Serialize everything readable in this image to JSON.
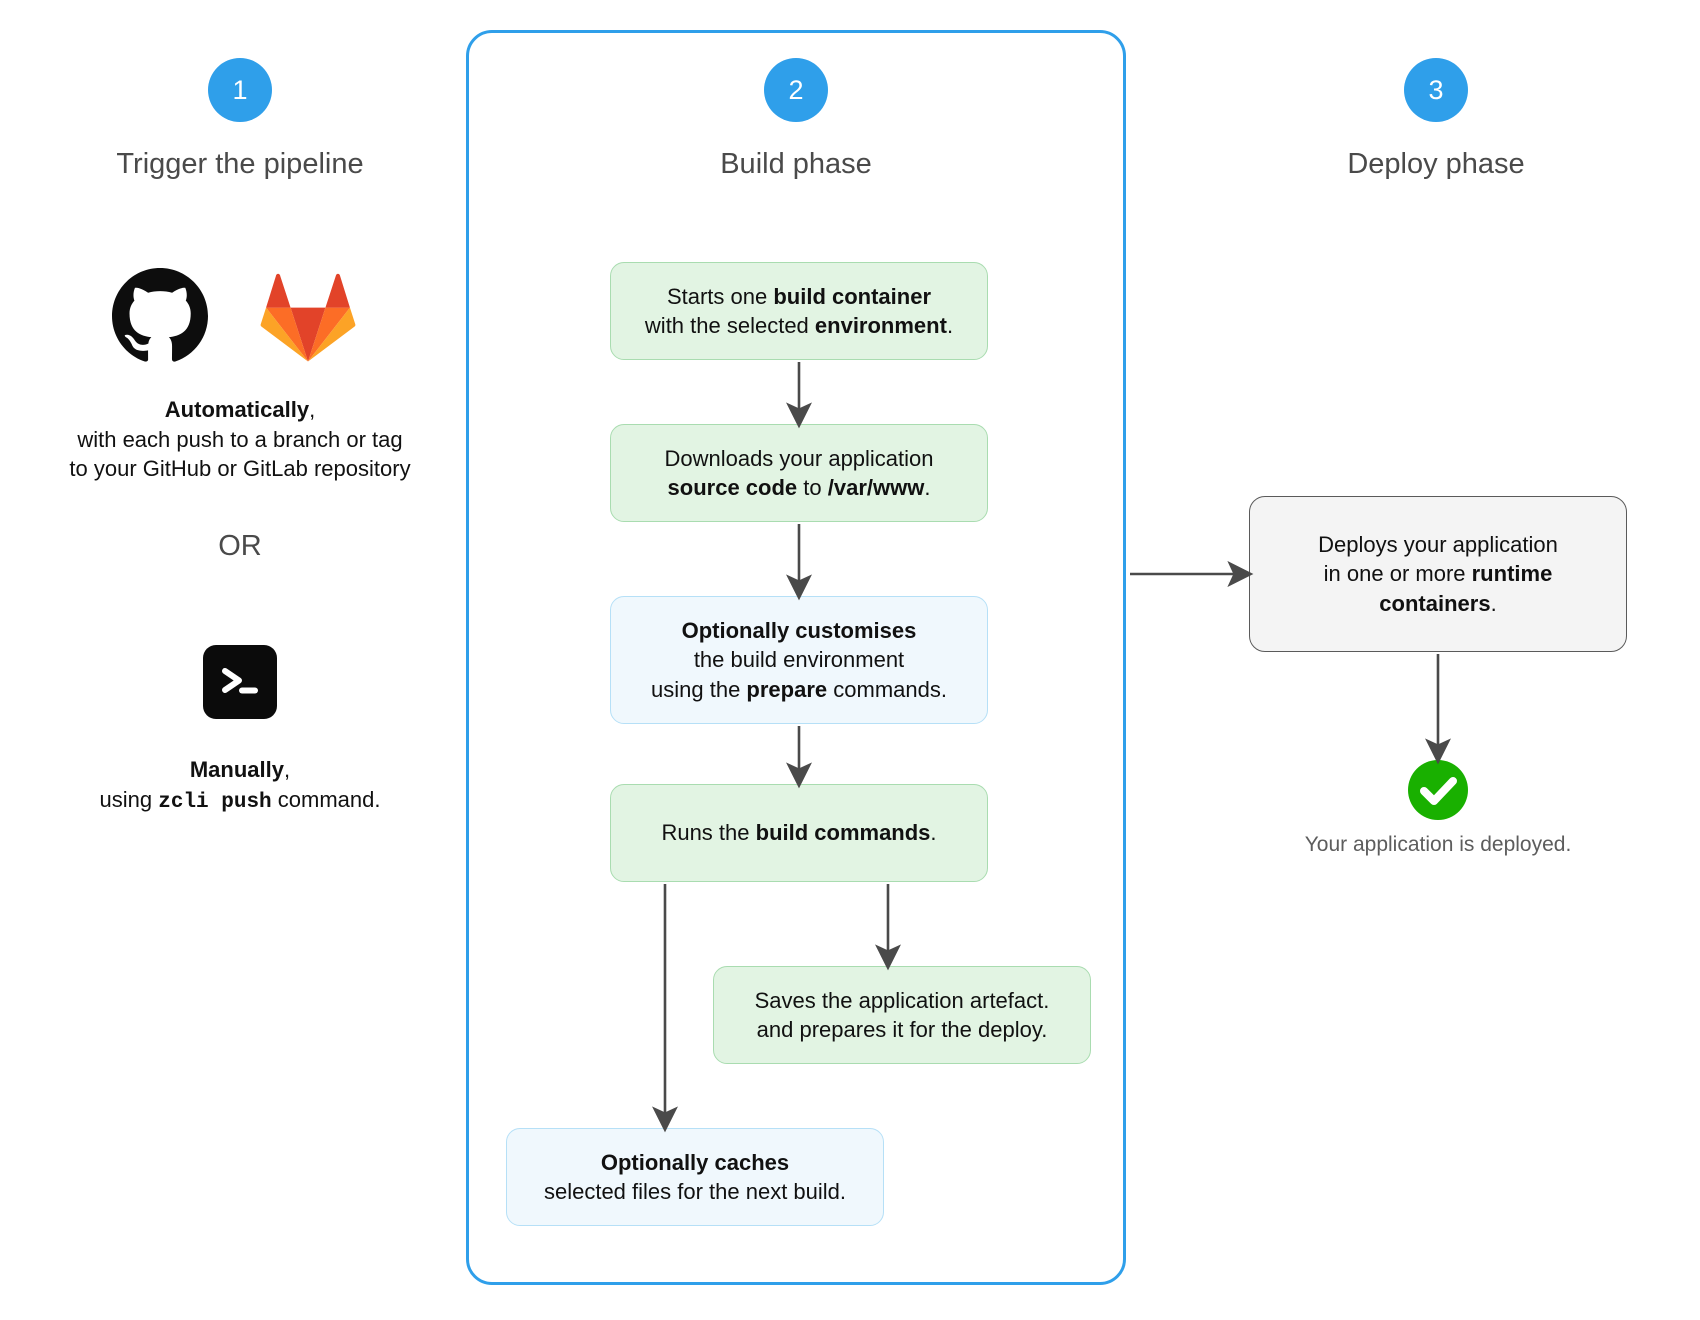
{
  "theme": {
    "accent_blue": "#2f9fea",
    "green_fill": "#e2f4e3",
    "green_border": "#a9dcb0",
    "blue_fill": "#f0f8fd",
    "blue_border": "#b6e0f7",
    "grey_fill": "#f4f4f4",
    "grey_border": "#5a5a5a",
    "success_green": "#19b000",
    "arrow_color": "#4a4a4a"
  },
  "steps": [
    {
      "number": "1",
      "title": "Trigger the pipeline"
    },
    {
      "number": "2",
      "title": "Build phase"
    },
    {
      "number": "3",
      "title": "Deploy phase"
    }
  ],
  "trigger": {
    "icons": [
      "github-icon",
      "gitlab-icon",
      "terminal-icon"
    ],
    "automatic": {
      "lead": "Automatically",
      "lead_suffix": ",",
      "line2": "with each push to a branch or tag",
      "line3": "to your GitHub or GitLab repository"
    },
    "or_label": "OR",
    "manual": {
      "lead": "Manually",
      "lead_suffix": ",",
      "line2_prefix": "using ",
      "command": "zcli push",
      "line2_suffix": " command."
    }
  },
  "build": {
    "boxes": [
      {
        "id": "build-container",
        "style": "green",
        "line1_pre": "Starts one ",
        "line1_bold": "build container",
        "line1_post": "",
        "line2_pre": "with the selected ",
        "line2_bold": "environment",
        "line2_post": "."
      },
      {
        "id": "source-code",
        "style": "green",
        "line1_pre": "Downloads your application",
        "line1_bold": "",
        "line1_post": "",
        "line2_pre": "",
        "line2_bold": "source code",
        "line2_post": " to ",
        "line2_bold2": "/var/www",
        "line2_end": "."
      },
      {
        "id": "prepare-commands",
        "style": "blue",
        "line1_bold": "Optionally customises",
        "line2": "the build environment",
        "line3_pre": "using the ",
        "line3_bold": "prepare",
        "line3_post": " commands."
      },
      {
        "id": "build-commands",
        "style": "green",
        "line1_pre": "Runs the ",
        "line1_bold": "build commands",
        "line1_post": "."
      },
      {
        "id": "save-artefact",
        "style": "green",
        "line1": "Saves the application artefact.",
        "line2": "and prepares it for the deploy."
      },
      {
        "id": "cache-files",
        "style": "blue",
        "line1_bold": "Optionally caches",
        "line2": "selected files for the next build."
      }
    ]
  },
  "deploy": {
    "box": {
      "id": "deploy-runtime",
      "style": "grey",
      "line1": "Deploys your application",
      "line2_pre": "in one or more ",
      "line2_bold": "runtime",
      "line3_bold": "containers",
      "line3_post": "."
    },
    "success_caption": "Your application is deployed."
  }
}
